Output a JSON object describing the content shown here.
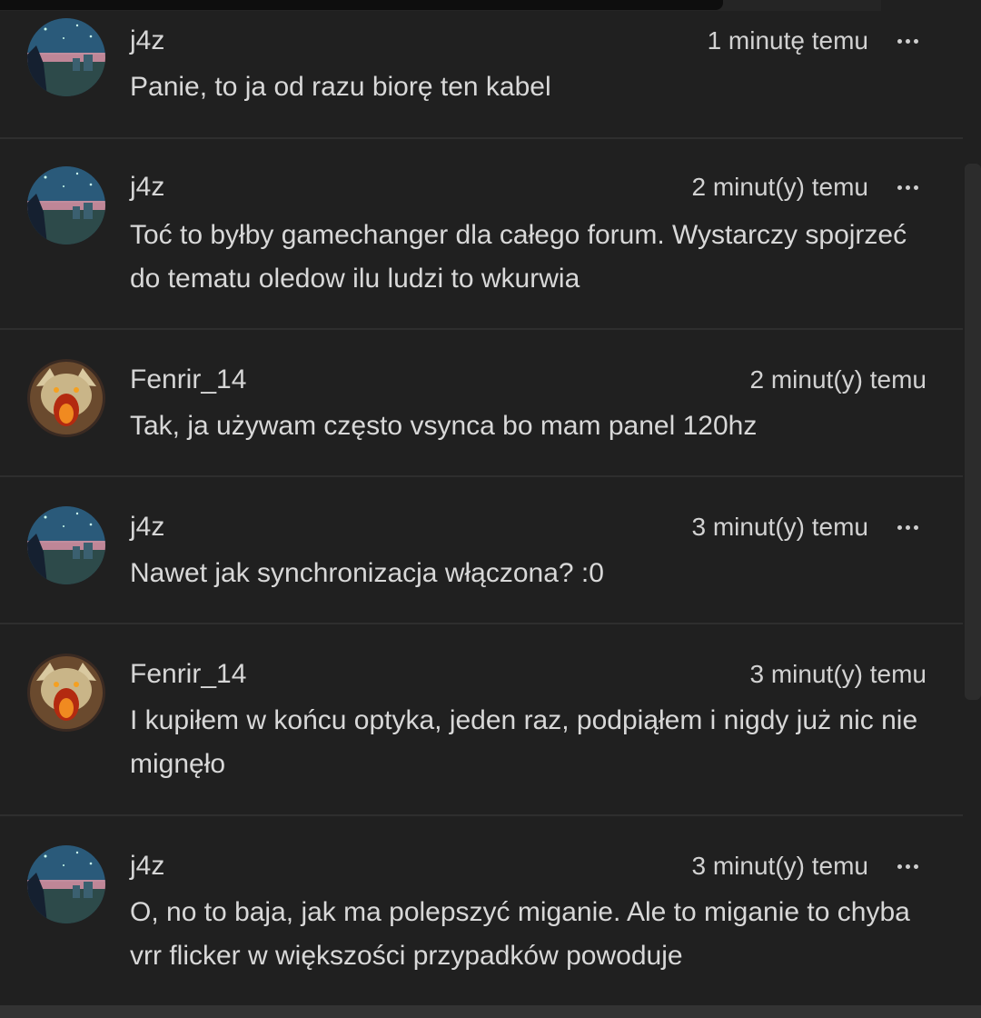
{
  "posts": [
    {
      "author": "j4z",
      "time": "1 minutę temu",
      "text": "Panie, to ja od razu biorę ten kabel",
      "has_menu": true,
      "avatar": "landscape-avatar"
    },
    {
      "author": "j4z",
      "time": "2 minut(y) temu",
      "text": "Toć to byłby gamechanger dla całego forum. Wystarczy spojrzeć do tematu oledow ilu ludzi to wkurwia",
      "has_menu": true,
      "avatar": "landscape-avatar"
    },
    {
      "author": "Fenrir_14",
      "time": "2 minut(y) temu",
      "text": "Tak, ja używam często vsynca bo mam panel 120hz",
      "has_menu": false,
      "avatar": "wolf-avatar"
    },
    {
      "author": "j4z",
      "time": "3 minut(y) temu",
      "text": "Nawet jak synchronizacja włączona? :0",
      "has_menu": true,
      "avatar": "landscape-avatar"
    },
    {
      "author": "Fenrir_14",
      "time": "3 minut(y) temu",
      "text": "I kupiłem w końcu optyka, jeden raz, podpiąłem i nigdy już nic nie mignęło",
      "has_menu": false,
      "avatar": "wolf-avatar"
    },
    {
      "author": "j4z",
      "time": "3 minut(y) temu",
      "text": "O, no to baja, jak ma polepszyć miganie. Ale to miganie to chyba vrr flicker w większości przypadków powoduje",
      "has_menu": true,
      "avatar": "landscape-avatar"
    }
  ],
  "colors": {
    "background": "#202020",
    "divider": "#2e2e2e",
    "text": "#d8d8d8"
  },
  "icons": {
    "menu": "more-horizontal-icon"
  }
}
